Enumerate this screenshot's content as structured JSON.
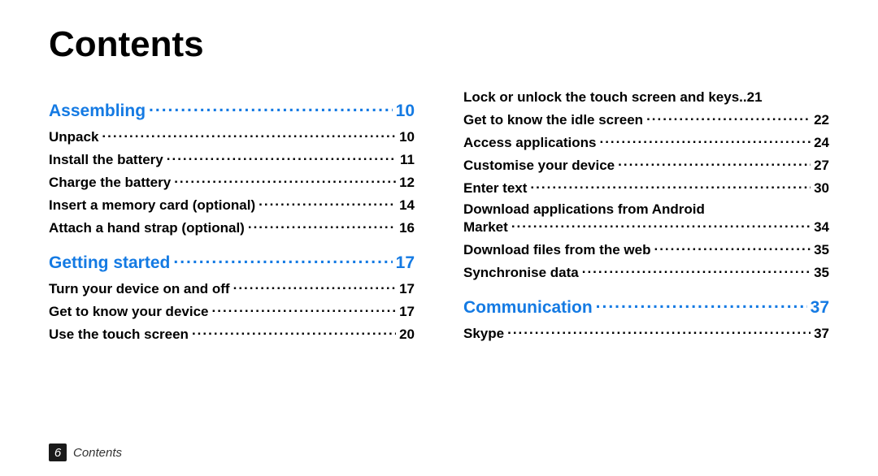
{
  "title": "Contents",
  "footer": {
    "page": "6",
    "label": "Contents"
  },
  "sections": [
    {
      "title": "Assembling",
      "page": "10",
      "col": 0,
      "items": [
        {
          "label": "Unpack",
          "page": "10"
        },
        {
          "label": "Install the battery",
          "page": "11"
        },
        {
          "label": "Charge the battery",
          "page": "12"
        },
        {
          "label": "Insert a memory card (optional)",
          "page": "14"
        },
        {
          "label": "Attach a hand strap (optional)",
          "page": "16"
        }
      ]
    },
    {
      "title": "Getting started",
      "page": "17",
      "col": 0,
      "items": [
        {
          "label": "Turn your device on and off",
          "page": "17"
        },
        {
          "label": "Get to know your device",
          "page": "17"
        },
        {
          "label": "Use the touch screen",
          "page": "20"
        }
      ]
    },
    {
      "col": 1,
      "continuation": true,
      "items": [
        {
          "label": "Lock or unlock the touch screen and keys",
          "page": "21",
          "tight": true
        },
        {
          "label": "Get to know the idle screen",
          "page": "22"
        },
        {
          "label": "Access applications",
          "page": "24"
        },
        {
          "label": "Customise your device",
          "page": "27"
        },
        {
          "label": "Enter text",
          "page": "30"
        },
        {
          "label": "Download applications from Android",
          "label2": "Market",
          "page": "34"
        },
        {
          "label": "Download files from the web",
          "page": "35"
        },
        {
          "label": "Synchronise data",
          "page": "35"
        }
      ]
    },
    {
      "title": "Communication",
      "page": "37",
      "col": 1,
      "items": [
        {
          "label": "Skype",
          "page": "37"
        }
      ]
    }
  ]
}
